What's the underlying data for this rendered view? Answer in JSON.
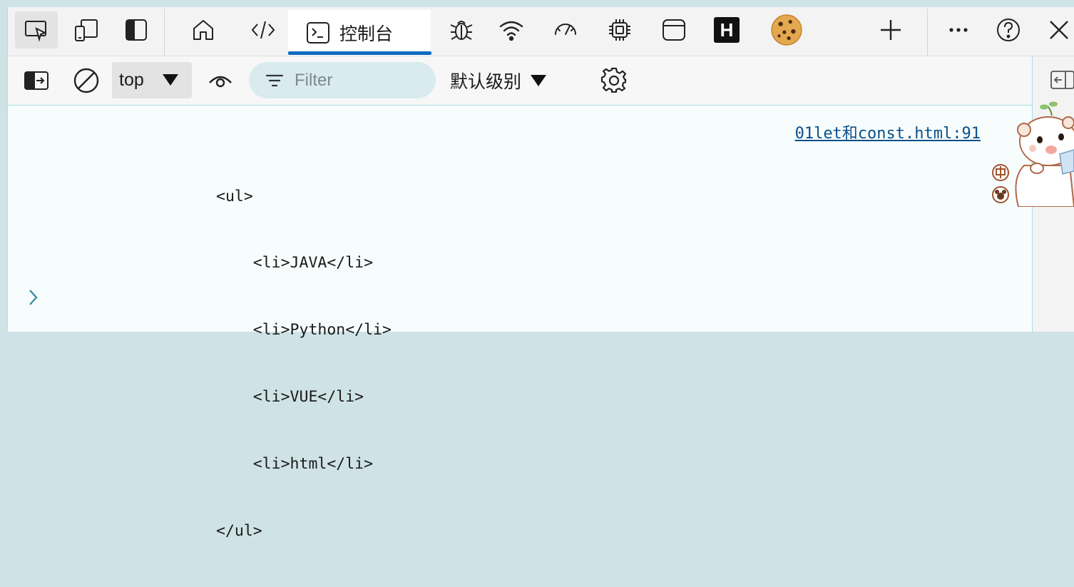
{
  "tabs": {
    "console_label": "控制台",
    "hack_letter": "H"
  },
  "console_toolbar": {
    "context_value": "top",
    "filter_placeholder": "Filter",
    "log_level": "默认级别"
  },
  "output": {
    "source_link": "01let和const.html:91",
    "lines": [
      "<ul>",
      "    <li>JAVA</li>",
      "    <li>Python</li>",
      "    <li>VUE</li>",
      "    <li>html</li>",
      "</ul>"
    ]
  },
  "colors": {
    "accent": "#0f6cbd",
    "link": "#0b4f8a",
    "console_bg": "#f7fdfd",
    "filter_bg": "#d9ebef",
    "border_teal": "#a7dde4"
  }
}
